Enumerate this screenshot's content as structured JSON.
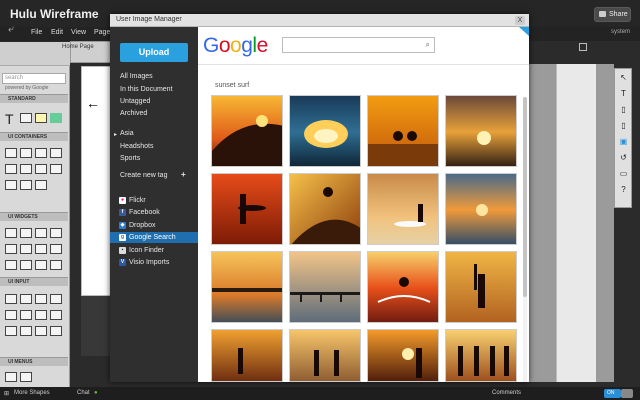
{
  "app": {
    "title": "Hulu Wireframe",
    "share_label": "Share",
    "user_label": "system"
  },
  "menubar": [
    "File",
    "Edit",
    "View",
    "Page"
  ],
  "left_panel": {
    "search_placeholder": "search",
    "powered_by": "powered by Google",
    "sections": [
      "STANDARD",
      "UI CONTAINERS",
      "UI WIDGETS",
      "UI INPUT",
      "UI MENUS"
    ],
    "page_tab": "Home Page"
  },
  "status_bar": {
    "more_shapes": "More Shapes",
    "chat": "Chat",
    "comments": "Comments",
    "toggle": "ON"
  },
  "modal": {
    "title": "User Image Manager",
    "close": "X",
    "upload_label": "Upload",
    "library": [
      "All Images",
      "In this Document",
      "Untagged",
      "Archived"
    ],
    "tags": [
      "Asia",
      "Headshots",
      "Sports"
    ],
    "create_tag": "Create new tag",
    "sources": [
      {
        "label": "Flickr",
        "icon": "flickr-icon",
        "color": "#ff0084"
      },
      {
        "label": "Facebook",
        "icon": "facebook-icon",
        "color": "#3b5998"
      },
      {
        "label": "Dropbox",
        "icon": "dropbox-icon",
        "color": "#2a7bd4"
      },
      {
        "label": "Google Search",
        "icon": "google-icon",
        "color": "#dddddd"
      },
      {
        "label": "Icon Finder",
        "icon": "iconfinder-icon",
        "color": "#dddddd"
      },
      {
        "label": "Visio Imports",
        "icon": "visio-icon",
        "color": "#2a57a6"
      }
    ],
    "active_source": "Google Search",
    "search_query": "sunset surf",
    "search_value": "",
    "google_logo": "Google"
  },
  "colors": {
    "accent": "#2aa0df",
    "active_row": "#1f6fb0",
    "sidebar": "#2f2f2f"
  }
}
